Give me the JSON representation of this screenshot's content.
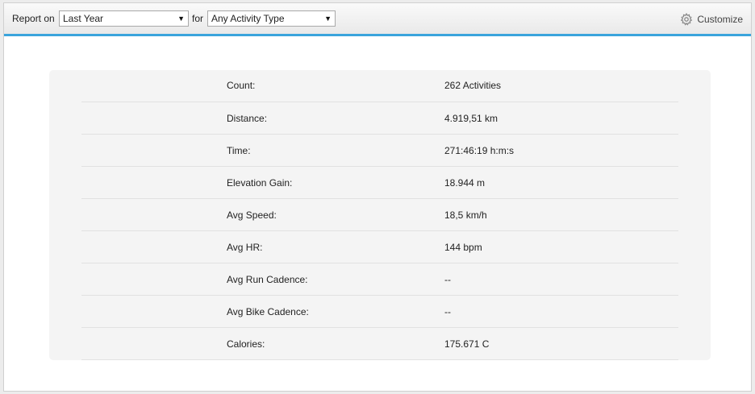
{
  "toolbar": {
    "report_on_label": "Report on",
    "period_select": "Last Year",
    "for_label": "for",
    "activity_select": "Any Activity Type",
    "customize_label": "Customize",
    "customize_icon": "gear-icon",
    "accent_color": "#3aa4dc"
  },
  "stats": [
    {
      "label": "Count:",
      "value": "262 Activities"
    },
    {
      "label": "Distance:",
      "value": "4.919,51 km"
    },
    {
      "label": "Time:",
      "value": "271:46:19 h:m:s"
    },
    {
      "label": "Elevation Gain:",
      "value": "18.944 m"
    },
    {
      "label": "Avg Speed:",
      "value": "18,5 km/h"
    },
    {
      "label": "Avg HR:",
      "value": "144 bpm"
    },
    {
      "label": "Avg Run Cadence:",
      "value": "--"
    },
    {
      "label": "Avg Bike Cadence:",
      "value": "--"
    },
    {
      "label": "Calories:",
      "value": "175.671 C"
    }
  ]
}
